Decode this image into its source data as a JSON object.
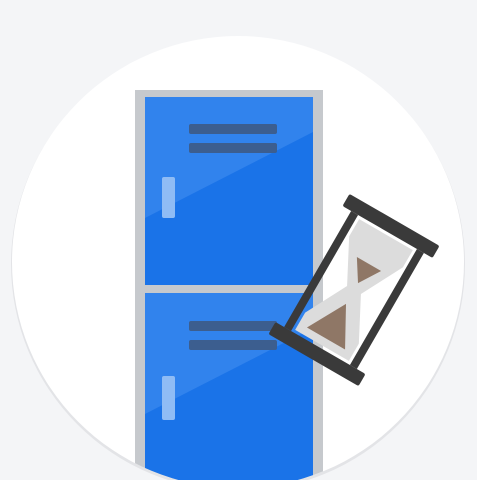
{
  "illustration": {
    "subject": "locker-with-hourglass-icon"
  },
  "colors": {
    "background": "#f4f5f7",
    "circle": "#ffffff",
    "circle_shadow": "#e3e4e7",
    "locker_frame": "#c6c9cd",
    "locker_body": "#1a73e8",
    "locker_highlight": "#5ea1f6",
    "locker_slot": "#3c5e8f",
    "locker_handle": "#8fbcf5",
    "hourglass_frame": "#3a3a3a",
    "hourglass_glass": "#dcdcdc",
    "hourglass_sand": "#8f7766"
  }
}
